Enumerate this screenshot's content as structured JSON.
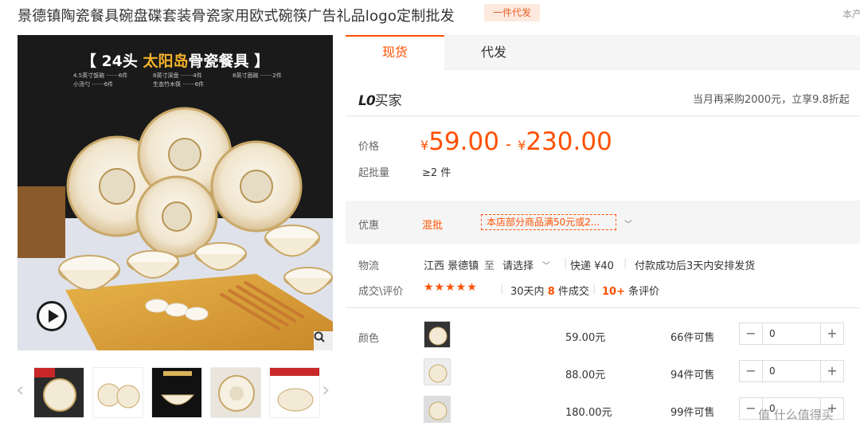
{
  "product": {
    "title": "景德镇陶瓷餐具碗盘碟套装骨瓷家用欧式碗筷广告礼品logo定制批发",
    "tag": "一件代发",
    "top_right": "本产"
  },
  "gallery": {
    "banner_prefix": "【 24头 ",
    "banner_highlight": "太阳岛",
    "banner_suffix": "骨瓷餐具 】",
    "specs": [
      "4.5英寸饭碗 ·······6件",
      "8英寸深盘 ·······4件",
      "8英寸面碗 ·······2件",
      "小汤勺 ·······6件",
      "生态竹木筷 ·······6件"
    ],
    "thumbs_count": 5
  },
  "tabs": [
    {
      "label": "现货"
    },
    {
      "label": "代发"
    }
  ],
  "buyer": {
    "level": "L0",
    "level_suffix": "买家",
    "promo": "当月再采购2000元，立享9.8折起"
  },
  "pricing": {
    "price_label": "价格",
    "currency": "¥",
    "min": "59.00",
    "max": "230.00",
    "moq_label": "起批量",
    "moq": "≥2 件"
  },
  "discount": {
    "label": "优惠",
    "type": "混批",
    "text": "本店部分商品满50元或2..."
  },
  "logistics": {
    "label": "物流",
    "origin": "江西 景德镇",
    "to": "至",
    "dest": "请选择",
    "express": "快递 ¥40",
    "ship_note": "付款成功后3天内安排发货"
  },
  "reviews": {
    "label": "成交\\评价",
    "stars": "★★★★★",
    "deals_prefix": "30天内",
    "deals_count": "8",
    "deals_suffix": "件成交",
    "review_count": "10+",
    "review_suffix": "条评价"
  },
  "sku": {
    "label": "颜色",
    "rows": [
      {
        "price": "59.00元",
        "stock": "66件可售",
        "qty": "0"
      },
      {
        "price": "88.00元",
        "stock": "94件可售",
        "qty": "0"
      },
      {
        "price": "180.00元",
        "stock": "99件可售",
        "qty": "0"
      }
    ]
  },
  "watermark": "值 什么值得买",
  "colors": {
    "accent": "#ff5000",
    "tag_bg": "#fde9de"
  }
}
